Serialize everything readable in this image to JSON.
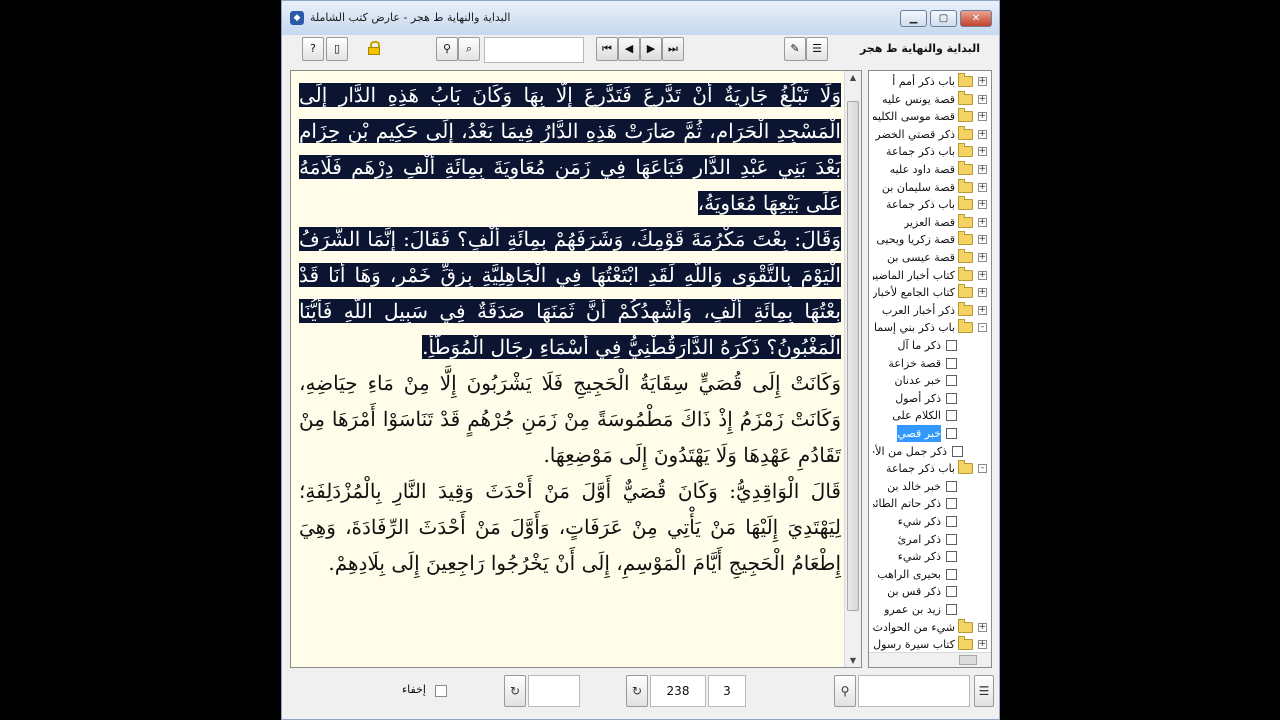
{
  "window": {
    "title": "البداية والنهاية ط هجر - عارض كتب الشاملة"
  },
  "toolbar": {
    "book_title": "البداية والنهاية ط هجر",
    "search_value": "",
    "icons": [
      "help-icon",
      "page-icon",
      "lock-icon",
      "binoculars-icon",
      "search-page-icon",
      "first-icon",
      "prev-icon",
      "next-icon",
      "last-icon",
      "open-icon",
      "notes-icon"
    ]
  },
  "text": {
    "highlighted": [
      "وَلَا تَبْلُغُ جَارِيَةٌ أَنْ تَدَّرِعَ فَتَدَّرِعَ إِلَّا بِهَا وَكَانَ بَابُ هَذِهِ الدَّارِ إِلَى الْمَسْجِدِ الْحَرَامِ، ثُمَّ صَارَتْ هَذِهِ الدَّارُ فِيمَا بَعْدُ، إِلَى حَكِيمِ بْنِ حِزَامٍ بَعْدَ بَنِي عَبْدِ الدَّارِ فَبَاعَهَا فِي زَمَنِ مُعَاوِيَةَ بِمِائَةِ أَلْفِ دِرْهَمٍ فَلَامَهُ عَلَى بَيْعِهَا مُعَاوِيَةُ،",
      "وَقَالَ: بِعْتَ مَكْرُمَةَ قَوْمِكَ، وَشَرَفَهُمْ بِمِائَةِ أَلْفٍ؟ فَقَالَ: إِنَّمَا الشَّرَفُ الْيَوْمَ بِالتَّقْوَى وَاللَّهِ لَقَدِ ابْتَعْتُهَا فِي الْجَاهِلِيَّةِ بِزِقِّ خَمْرٍ، وَهَا أَنَا قَدْ بِعْتُهَا بِمِائَةِ أَلْفٍ، وَأُشْهِدُكُمْ أَنَّ ثَمَنَهَا صَدَقَةٌ فِي سَبِيلِ اللَّهِ فَأَيُّنَا الْمَغْبُونُ؟ ذَكَرَهُ الدَّارَقُطْنِيُّ فِي أَسْمَاءِ رِجَالِ الْمُوَطَّأِ."
    ],
    "paragraphs": [
      "وَكَانَتْ إِلَى قُصَيٍّ سِقَايَةُ الْحَجِيجِ فَلَا يَشْرَبُونَ إِلَّا مِنْ مَاءِ حِيَاضِهِ، وَكَانَتْ زَمْزَمُ إِذْ ذَاكَ مَطْمُوسَةً مِنْ زَمَنِ جُرْهُمٍ قَدْ تَنَاسَوْا أَمْرَهَا مِنْ تَقَادُمِ عَهْدِهَا وَلَا يَهْتَدُونَ إِلَى مَوْضِعِهَا.",
      "قَالَ الْوَاقِدِيُّ: وَكَانَ قُصَيٌّ أَوَّلَ مَنْ أَحْدَثَ وَقِيدَ النَّارِ بِالْمُزْدَلِفَةِ؛ لِيَهْتَدِيَ إِلَيْهَا مَنْ يَأْتِي مِنْ عَرَفَاتٍ، وَأَوَّلَ مَنْ أَحْدَثَ الرِّفَادَةَ، وَهِيَ إِطْعَامُ الْحَجِيجِ أَيَّامَ الْمَوْسِمِ، إِلَى أَنْ يَخْرُجُوا رَاجِعِينَ إِلَى بِلَادِهِمْ."
    ]
  },
  "tree": {
    "items": [
      {
        "label": "باب ذكر أمم أ",
        "type": "folder",
        "exp": "+"
      },
      {
        "label": "قصة يونس عليه",
        "type": "folder",
        "exp": "+"
      },
      {
        "label": "قصة موسى الكليم",
        "type": "folder",
        "exp": "+"
      },
      {
        "label": "ذكر قصتي الخضر",
        "type": "folder",
        "exp": "+"
      },
      {
        "label": "باب ذكر جماعة",
        "type": "folder",
        "exp": "+"
      },
      {
        "label": "قصة داود عليه",
        "type": "folder",
        "exp": "+"
      },
      {
        "label": "قصة سليمان بن",
        "type": "folder",
        "exp": "+"
      },
      {
        "label": "باب ذكر جماعة",
        "type": "folder",
        "exp": "+"
      },
      {
        "label": "قصة العزير",
        "type": "folder",
        "exp": "+"
      },
      {
        "label": "قصة زكريا ويحيى",
        "type": "folder",
        "exp": "+"
      },
      {
        "label": "قصة عيسى بن",
        "type": "folder",
        "exp": "+"
      },
      {
        "label": "كتاب أخبار الماضين",
        "type": "folder",
        "exp": "+"
      },
      {
        "label": "كتاب الجامع لأخبار",
        "type": "folder",
        "exp": "+"
      },
      {
        "label": "ذكر أخبار العرب",
        "type": "folder",
        "exp": "+"
      },
      {
        "label": "باب ذكر بني إسماعيل",
        "type": "folder-open",
        "exp": "-"
      },
      {
        "label": "ذكر ما آل",
        "type": "doc",
        "indent": 1
      },
      {
        "label": "قصة خزاعة",
        "type": "doc",
        "indent": 1
      },
      {
        "label": "خبر عدنان",
        "type": "doc",
        "indent": 1
      },
      {
        "label": "ذكر أصول",
        "type": "doc",
        "indent": 1
      },
      {
        "label": "الكلام على",
        "type": "doc",
        "indent": 1
      },
      {
        "label": "خبر قصي",
        "type": "doc",
        "indent": 1,
        "selected": true
      },
      {
        "label": "ذكر جمل من الأحداث",
        "type": "doc",
        "indent": 0
      },
      {
        "label": "باب ذكر جماعة",
        "type": "folder-open",
        "exp": "-"
      },
      {
        "label": "خبر خالد بن",
        "type": "doc",
        "indent": 1
      },
      {
        "label": "ذكر حاتم الطائي",
        "type": "doc",
        "indent": 1
      },
      {
        "label": "ذكر شيء",
        "type": "doc",
        "indent": 1
      },
      {
        "label": "ذكر امرئ",
        "type": "doc",
        "indent": 1
      },
      {
        "label": "ذكر شيء",
        "type": "doc",
        "indent": 1
      },
      {
        "label": "بحيرى الراهب",
        "type": "doc",
        "indent": 1
      },
      {
        "label": "ذكر قس بن",
        "type": "doc",
        "indent": 1
      },
      {
        "label": "زيد بن عمرو",
        "type": "doc",
        "indent": 1
      },
      {
        "label": "شيء من الحوادث",
        "type": "folder",
        "exp": "+"
      },
      {
        "label": "كتاب سيرة رسول",
        "type": "folder",
        "exp": "+"
      }
    ]
  },
  "status": {
    "hide_label": "إخفاء",
    "page": "238",
    "part": "3",
    "find_value": ""
  }
}
